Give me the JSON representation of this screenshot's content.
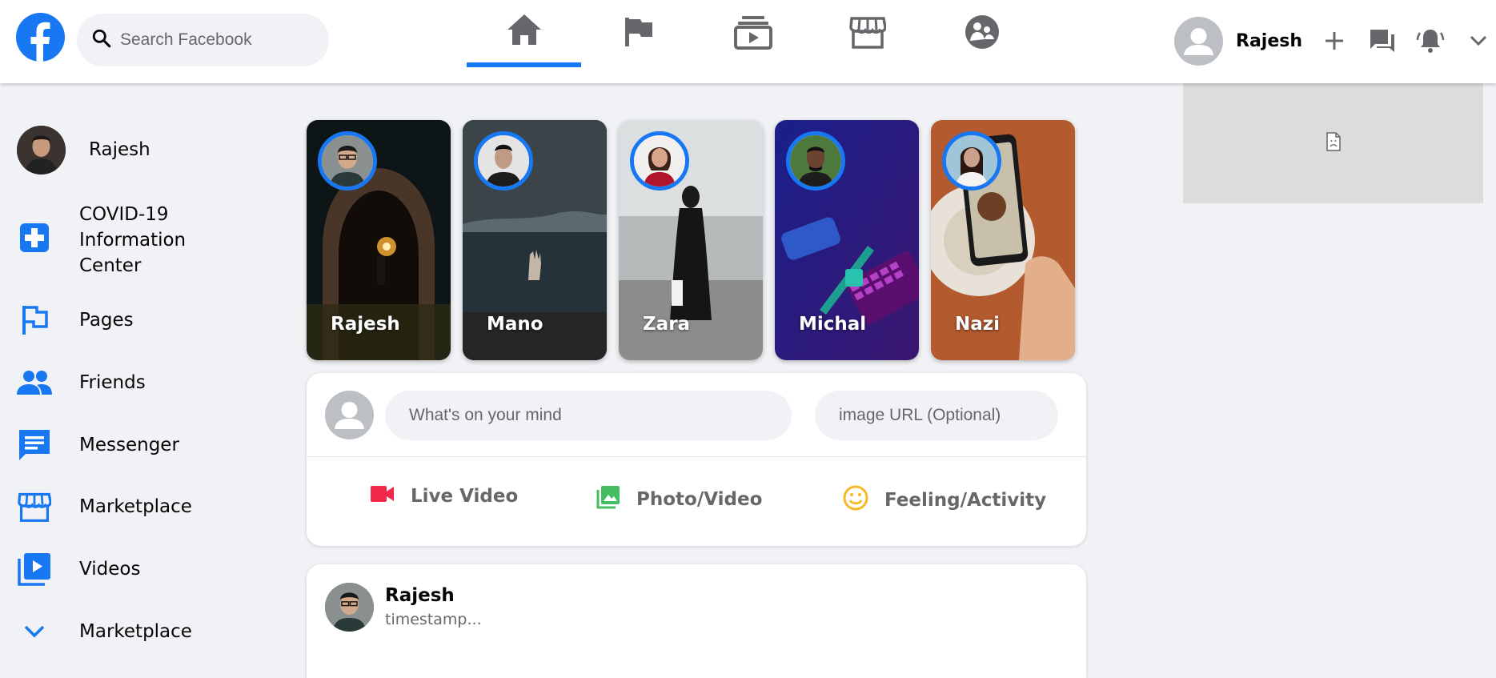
{
  "header": {
    "search_placeholder": "Search Facebook",
    "nav_tabs": [
      {
        "name": "home",
        "icon": "home-icon",
        "active": true
      },
      {
        "name": "pages",
        "icon": "flag-icon",
        "active": false
      },
      {
        "name": "watch",
        "icon": "video-stack-icon",
        "active": false
      },
      {
        "name": "marketplace",
        "icon": "store-icon",
        "active": false
      },
      {
        "name": "groups",
        "icon": "groups-icon",
        "active": false
      }
    ],
    "user_name": "Rajesh"
  },
  "sidebar": {
    "profile_name": "Rajesh",
    "items": [
      {
        "label": "COVID-19\nInformation\nCenter",
        "icon": "plus-box-icon"
      },
      {
        "label": "Pages",
        "icon": "flag-icon"
      },
      {
        "label": "Friends",
        "icon": "people-icon"
      },
      {
        "label": "Messenger",
        "icon": "chat-icon"
      },
      {
        "label": "Marketplace",
        "icon": "store-icon"
      },
      {
        "label": "Videos",
        "icon": "video-library-icon"
      },
      {
        "label": "Marketplace",
        "icon": "chevron-down-icon"
      }
    ]
  },
  "stories": [
    {
      "name": "Rajesh"
    },
    {
      "name": "Mano"
    },
    {
      "name": "Zara"
    },
    {
      "name": "Michal"
    },
    {
      "name": "Nazi"
    }
  ],
  "composer": {
    "message_placeholder": "What's on your mind",
    "image_placeholder": "image URL (Optional)",
    "actions": [
      {
        "label": "Live Video",
        "icon": "videocam-icon",
        "color": "#f02849"
      },
      {
        "label": "Photo/Video",
        "icon": "photo-library-icon",
        "color": "#45bd62"
      },
      {
        "label": "Feeling/Activity",
        "icon": "smiley-icon",
        "color": "#f7b928"
      }
    ]
  },
  "post": {
    "author": "Rajesh",
    "timestamp": "timestamp..."
  },
  "colors": {
    "brand": "#1877f2",
    "background": "#f0f2f5"
  }
}
